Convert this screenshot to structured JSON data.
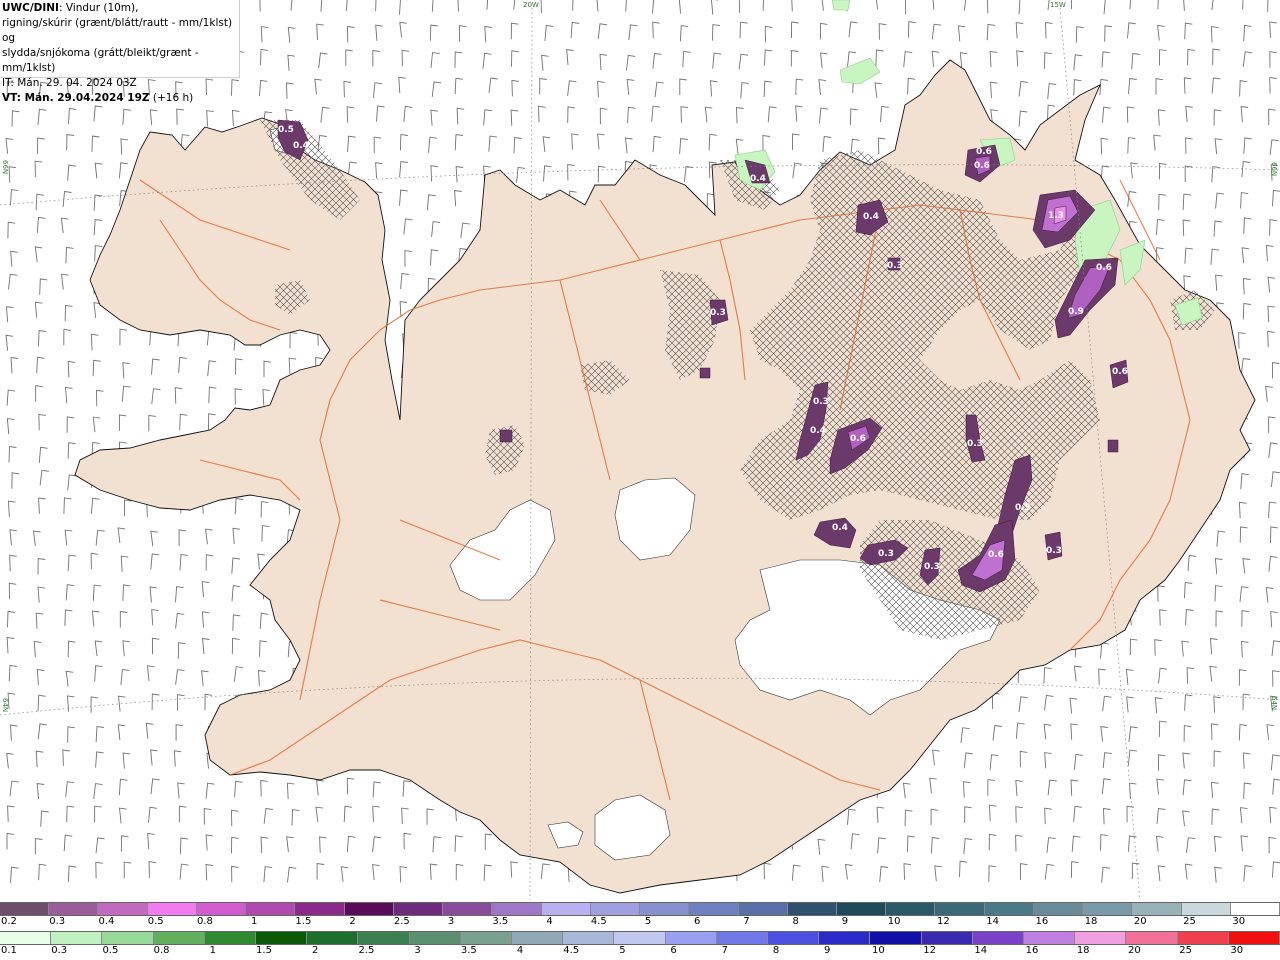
{
  "header": {
    "model": "UWC/DINI",
    "line1_rest": ": Vindur (10m),",
    "line2": "rigning/skúrir (grænt/blátt/rautt - mm/1klst) og",
    "line3": "slydda/snjókoma (grátt/bleikt/grænt - mm/1klst)",
    "line4": "IT: Mán. 29. 04. 2024 03Z",
    "vt_label": "VT: Mán. 29.04.2024 19Z",
    "vt_rest": " (+16 h)"
  },
  "grid_labels": {
    "lon_20w": "20W",
    "lon_15w": "15W",
    "lat_66n_left": "66N",
    "lat_66n_right": "66N",
    "lat_64n_left": "64N",
    "lat_64n_right": "64N"
  },
  "precip_values": [
    "0.5",
    "0.4",
    "0.4",
    "0.6",
    "0.6",
    "0.4",
    "1.3",
    "0.3",
    "0.6",
    "0.3",
    "0.9",
    "0.3",
    "0.6",
    "0.4",
    "0.6",
    "0.3",
    "0.5",
    "0.4",
    "0.3",
    "0.3",
    "0.6",
    "0.3"
  ],
  "snow_scale": {
    "labels": [
      "0.2",
      "0.3",
      "0.4",
      "0.5",
      "0.8",
      "1",
      "1.5",
      "2",
      "2.5",
      "3",
      "3.5",
      "4",
      "4.5",
      "5",
      "6",
      "7",
      "8",
      "9",
      "10",
      "12",
      "14",
      "16",
      "18",
      "20",
      "25",
      "30"
    ],
    "colors": [
      "#6b4f6b",
      "#9a5c9a",
      "#c06ac0",
      "#f07cf0",
      "#d05cd0",
      "#b04ab0",
      "#8a2a8a",
      "#5a0a5a",
      "#6e2a7e",
      "#8a4a9e",
      "#9e78c8",
      "#b8b0f0",
      "#a0a0e0",
      "#8890d0",
      "#6f80c0",
      "#5a70a8",
      "#305070",
      "#1e4a5a",
      "#2a5a6a",
      "#3a6a78",
      "#4a7a88",
      "#6a8a98",
      "#7a9aa8",
      "#98b0b8",
      "#c8d8dc",
      "#ffffff"
    ]
  },
  "rain_scale": {
    "labels": [
      "0.1",
      "0.3",
      "0.5",
      "0.8",
      "1",
      "1.5",
      "2",
      "2.5",
      "3",
      "3.5",
      "4",
      "4.5",
      "5",
      "6",
      "7",
      "8",
      "9",
      "10",
      "12",
      "14",
      "16",
      "18",
      "20",
      "25",
      "30"
    ],
    "colors": [
      "#e6ffe6",
      "#c0f0c0",
      "#98d898",
      "#60b060",
      "#308a30",
      "#0a5a0a",
      "#1e6e2e",
      "#3a8050",
      "#5a9070",
      "#7aa090",
      "#90a8b8",
      "#a8b8d8",
      "#c0c8f0",
      "#9aa0f0",
      "#7078e8",
      "#4a50e0",
      "#2a2ac8",
      "#1010a8",
      "#3a2ab0",
      "#7a40c8",
      "#c080e0",
      "#f0a0e0",
      "#f07098",
      "#f04050",
      "#f01010"
    ]
  }
}
